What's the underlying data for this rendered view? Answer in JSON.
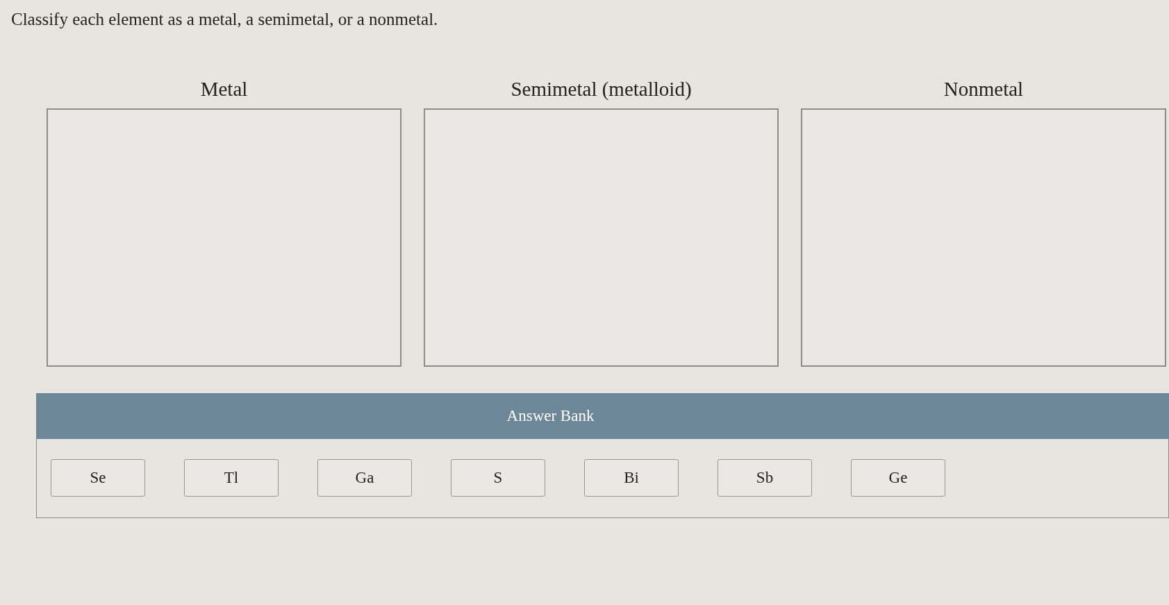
{
  "prompt": "Classify each element as a metal, a semimetal, or a nonmetal.",
  "bins": [
    {
      "label": "Metal"
    },
    {
      "label": "Semimetal (metalloid)"
    },
    {
      "label": "Nonmetal"
    }
  ],
  "answer_bank": {
    "title": "Answer Bank",
    "items": [
      "Se",
      "Tl",
      "Ga",
      "S",
      "Bi",
      "Sb",
      "Ge"
    ]
  }
}
